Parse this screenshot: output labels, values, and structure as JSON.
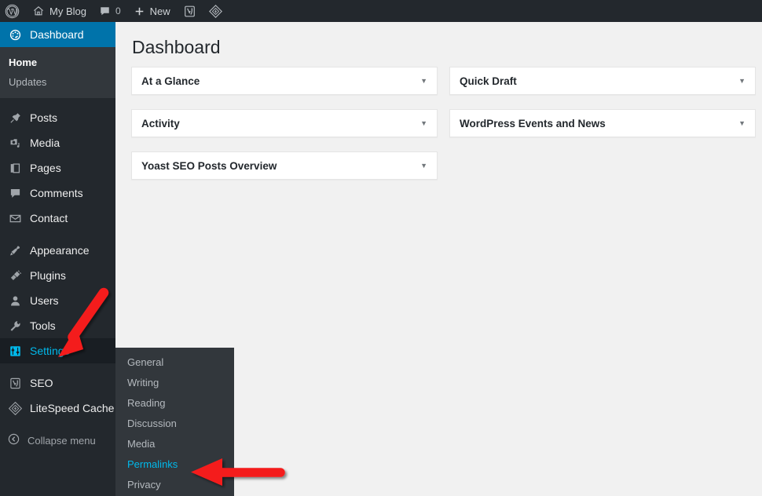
{
  "adminbar": {
    "items": [
      {
        "name": "wp-logo",
        "icon": "wordpress-icon",
        "label": ""
      },
      {
        "name": "site-name",
        "icon": "home-icon",
        "label": "My Blog"
      },
      {
        "name": "comments",
        "icon": "comment-bubble-icon",
        "label": "0"
      },
      {
        "name": "new-content",
        "icon": "plus-icon",
        "label": "New"
      },
      {
        "name": "yoast-seo",
        "icon": "yoast-icon",
        "label": ""
      },
      {
        "name": "litespeed-cache",
        "icon": "litespeed-diamond-icon",
        "label": ""
      }
    ]
  },
  "sidebar": {
    "items": [
      {
        "label": "Dashboard",
        "icon": "dashboard-gauge-icon",
        "state": "current"
      },
      {
        "label": "Posts",
        "icon": "pin-icon",
        "state": "normal"
      },
      {
        "label": "Media",
        "icon": "media-camera-icon",
        "state": "normal"
      },
      {
        "label": "Pages",
        "icon": "pages-icon",
        "state": "normal"
      },
      {
        "label": "Comments",
        "icon": "comment-bubble-icon",
        "state": "normal"
      },
      {
        "label": "Contact",
        "icon": "envelope-icon",
        "state": "normal"
      },
      {
        "label": "Appearance",
        "icon": "paintbrush-icon",
        "state": "normal"
      },
      {
        "label": "Plugins",
        "icon": "plug-icon",
        "state": "normal"
      },
      {
        "label": "Users",
        "icon": "user-icon",
        "state": "normal"
      },
      {
        "label": "Tools",
        "icon": "wrench-icon",
        "state": "normal"
      },
      {
        "label": "Settings",
        "icon": "settings-sliders-icon",
        "state": "open"
      },
      {
        "label": "SEO",
        "icon": "yoast-icon",
        "state": "normal"
      },
      {
        "label": "LiteSpeed Cache",
        "icon": "litespeed-diamond-icon",
        "state": "normal"
      }
    ],
    "dashboard_submenu": [
      {
        "label": "Home",
        "current": true
      },
      {
        "label": "Updates",
        "current": false
      }
    ],
    "collapse": {
      "label": "Collapse menu",
      "icon": "collapse-arrow-icon"
    }
  },
  "settings_flyout": {
    "items": [
      {
        "label": "General",
        "current": false
      },
      {
        "label": "Writing",
        "current": false
      },
      {
        "label": "Reading",
        "current": false
      },
      {
        "label": "Discussion",
        "current": false
      },
      {
        "label": "Media",
        "current": false
      },
      {
        "label": "Permalinks",
        "current": true
      },
      {
        "label": "Privacy",
        "current": false
      }
    ]
  },
  "main": {
    "title": "Dashboard",
    "caret": "▼",
    "panels_left": [
      {
        "title": "At a Glance"
      },
      {
        "title": "Activity"
      },
      {
        "title": "Yoast SEO Posts Overview"
      }
    ],
    "panels_right": [
      {
        "title": "Quick Draft"
      },
      {
        "title": "WordPress Events and News"
      }
    ]
  },
  "annotations": {
    "arrow_color": "#f41b1b",
    "arrows": [
      {
        "name": "arrow-to-settings",
        "points_to": "Settings"
      },
      {
        "name": "arrow-to-permalinks",
        "points_to": "Permalinks"
      }
    ]
  },
  "colors": {
    "adminbar_bg": "#23282d",
    "sidebar_bg": "#23282d",
    "submenu_bg": "#32373c",
    "current_blue": "#0073aa",
    "link_blue": "#00b9eb",
    "content_bg": "#f1f1f1"
  }
}
